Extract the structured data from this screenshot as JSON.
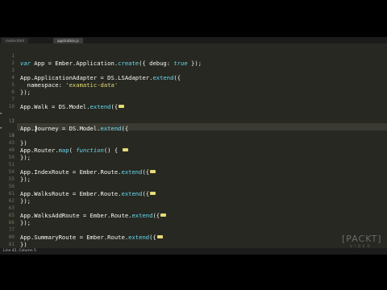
{
  "tabs": [
    {
      "label": "routes.html",
      "active": false
    },
    {
      "label": "application.js",
      "active": true
    }
  ],
  "status": {
    "text": "Line 42, Column 5"
  },
  "branding": {
    "brand": "[PACKT]",
    "sub": "VIDEO"
  },
  "colors": {
    "editor_bg": "#272822",
    "keyword": "#66d9ef",
    "string": "#e6db74",
    "text": "#f8f8f2",
    "line_number": "#75715e"
  },
  "code_lines": [
    {
      "n": "1",
      "text": "var App = Ember.Application.create({ debug: true });"
    },
    {
      "n": "2",
      "text": ""
    },
    {
      "n": "3",
      "text": "App.ApplicationAdapter = DS.LSAdapter.extend({"
    },
    {
      "n": "4",
      "text": "  namespace: 'examatic-data'"
    },
    {
      "n": "5",
      "text": "});"
    },
    {
      "n": "6",
      "text": ""
    },
    {
      "n": "7",
      "text": "App.Walk = DS.Model.extend({"
    },
    {
      "n": "10",
      "text": ""
    },
    {
      "n": "11",
      "text": "App.Journey = DS.Model.extend({"
    },
    {
      "n": "12",
      "text": ""
    },
    {
      "n": "13",
      "text": "})"
    },
    {
      "n": "14",
      "text": ""
    },
    {
      "n": "43",
      "text": "App.Router.map( function() {"
    },
    {
      "n": "49",
      "text": "});"
    },
    {
      "n": "50",
      "text": ""
    },
    {
      "n": "51",
      "text": "App.IndexRoute = Ember.Route.extend({"
    },
    {
      "n": "54",
      "text": "});"
    },
    {
      "n": "55",
      "text": ""
    },
    {
      "n": "56",
      "text": "App.WalksRoute = Ember.Route.extend({"
    },
    {
      "n": "61",
      "text": "});"
    },
    {
      "n": "62",
      "text": ""
    },
    {
      "n": "63",
      "text": "App.WalksAddRoute = Ember.Route.extend({"
    },
    {
      "n": "65",
      "text": "});"
    },
    {
      "n": "66",
      "text": ""
    },
    {
      "n": "77",
      "text": "App.SummaryRoute = Ember.Route.extend({"
    },
    {
      "n": "80",
      "text": "})"
    },
    {
      "n": "81",
      "text": ""
    },
    {
      "n": "82",
      "text": ""
    }
  ]
}
